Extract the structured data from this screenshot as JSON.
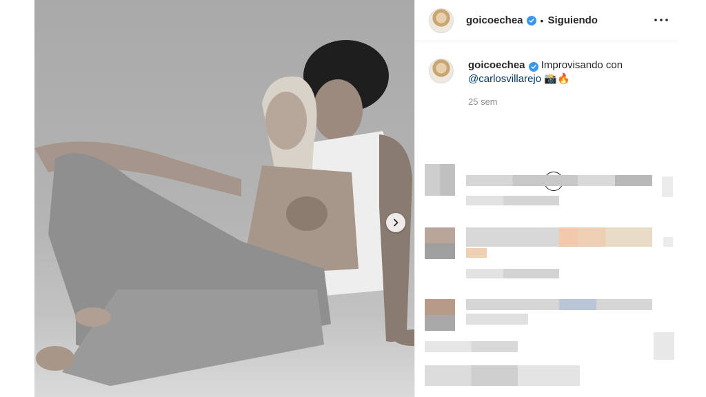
{
  "post": {
    "author": {
      "username": "goicoechea",
      "verified": true,
      "follow_status": "Siguiendo",
      "separator": "•"
    },
    "caption": {
      "text": "Improvisando con",
      "mention": "@carlosvillarejo",
      "emoji": "📸🔥"
    },
    "timestamp": "25 sem",
    "icons": {
      "more": "more-options-icon",
      "verified": "verified-badge-icon",
      "next": "chevron-right-icon",
      "load_more": "plus-circle-icon"
    }
  },
  "colors": {
    "verified_blue": "#3897f0",
    "mention_blue": "#00376b",
    "muted_gray": "#8e8e8e",
    "text": "#262626"
  }
}
